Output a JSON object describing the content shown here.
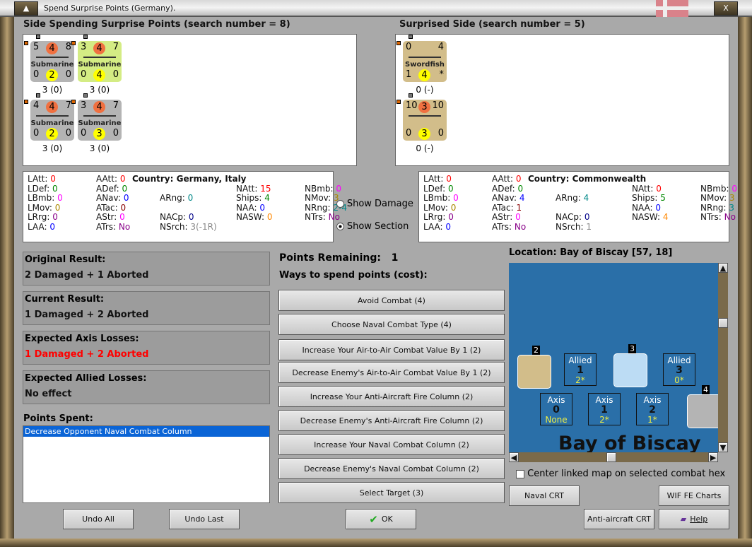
{
  "window": {
    "title": "Spend Surprise Points (Germany)."
  },
  "left_header": "Side Spending Surprise Points (search number = 8)",
  "right_header": "Surprised Side (search number = 5)",
  "left_units": [
    {
      "type": "Submarine",
      "top": [
        "5",
        "4",
        "8"
      ],
      "bottom": [
        "0",
        "2",
        "0"
      ],
      "caption": "3 (0)",
      "bg": "#b4b4b4"
    },
    {
      "type": "Submarine",
      "top": [
        "3",
        "4",
        "7"
      ],
      "bottom": [
        "0",
        "4",
        "0"
      ],
      "caption": "3 (0)",
      "bg": "#d4ec84"
    },
    {
      "type": "Submarine",
      "top": [
        "4",
        "4",
        "7"
      ],
      "bottom": [
        "0",
        "2",
        "0"
      ],
      "caption": "3 (0)",
      "bg": "#b4b4b4"
    },
    {
      "type": "Submarine",
      "top": [
        "3",
        "4",
        "7"
      ],
      "bottom": [
        "0",
        "3",
        "0"
      ],
      "caption": "3 (0)",
      "bg": "#b4b4b4"
    }
  ],
  "right_units": [
    {
      "type": "Swordfish",
      "top": [
        "0",
        "",
        "4"
      ],
      "bottom": [
        "1",
        "4",
        "*"
      ],
      "caption": "0 (-)",
      "bg": "#d2bd8a"
    },
    {
      "type": "",
      "top": [
        "10",
        "3",
        "10"
      ],
      "bottom": [
        "0",
        "3",
        "0"
      ],
      "caption": "0 (-)",
      "bg": "#d2bd8a"
    }
  ],
  "left_stats": {
    "country": "Country: Germany, Italy",
    "items": [
      [
        "LAtt:",
        "0",
        "#f00"
      ],
      [
        "LDef:",
        "0",
        "#080"
      ],
      [
        "LBmb:",
        "0",
        "#f0f"
      ],
      [
        "LMov:",
        "0",
        "#a80"
      ],
      [
        "LRrg:",
        "0",
        "#808"
      ],
      [
        "LAA:",
        "0",
        "#00f"
      ],
      [
        "AAtt:",
        "0",
        "#f00"
      ],
      [
        "ADef:",
        "0",
        "#080"
      ],
      [
        "ANav:",
        "0",
        "#00f"
      ],
      [
        "ATac:",
        "0",
        "#800"
      ],
      [
        "AStr:",
        "0",
        "#f0f"
      ],
      [
        "ATrs:",
        "No",
        "#808"
      ],
      [
        "ARng:",
        "0",
        "#088"
      ],
      [
        "NACp:",
        "0",
        "#008"
      ],
      [
        "NSrch:",
        "3(-1R)",
        "#888"
      ],
      [
        "NAtt:",
        "15",
        "#f00"
      ],
      [
        "Ships:",
        "4",
        "#080"
      ],
      [
        "NAA:",
        "0",
        "#00f"
      ],
      [
        "NASW:",
        "0",
        "#f80"
      ],
      [
        "NBmb:",
        "0",
        "#f0f"
      ],
      [
        "NMov:",
        "3",
        "#a80"
      ],
      [
        "NRng:",
        "2-4",
        "#088"
      ],
      [
        "NTrs:",
        "No",
        "#808"
      ]
    ]
  },
  "right_stats": {
    "country": "Country: Commonwealth",
    "items": [
      [
        "LAtt:",
        "0",
        "#f00"
      ],
      [
        "LDef:",
        "0",
        "#080"
      ],
      [
        "LBmb:",
        "0",
        "#f0f"
      ],
      [
        "LMov:",
        "0",
        "#a80"
      ],
      [
        "LRrg:",
        "0",
        "#808"
      ],
      [
        "LAA:",
        "0",
        "#00f"
      ],
      [
        "AAtt:",
        "0",
        "#f00"
      ],
      [
        "ADef:",
        "0",
        "#080"
      ],
      [
        "ANav:",
        "4",
        "#00f"
      ],
      [
        "ATac:",
        "1",
        "#800"
      ],
      [
        "AStr:",
        "0",
        "#f0f"
      ],
      [
        "ATrs:",
        "No",
        "#808"
      ],
      [
        "ARng:",
        "4",
        "#088"
      ],
      [
        "NACp:",
        "0",
        "#008"
      ],
      [
        "NSrch:",
        "1",
        "#888"
      ],
      [
        "NAtt:",
        "0",
        "#f00"
      ],
      [
        "Ships:",
        "5",
        "#080"
      ],
      [
        "NAA:",
        "0",
        "#00f"
      ],
      [
        "NASW:",
        "4",
        "#f80"
      ],
      [
        "NBmb:",
        "0",
        "#f0f"
      ],
      [
        "NMov:",
        "3",
        "#a80"
      ],
      [
        "NRng:",
        "3",
        "#088"
      ],
      [
        "NTrs:",
        "No",
        "#808"
      ]
    ]
  },
  "options": {
    "show_damage": "Show Damage",
    "show_section": "Show Section",
    "selected": "show_section"
  },
  "results": [
    {
      "label": "Original Result:",
      "value": "2 Damaged + 1 Aborted",
      "color": "#111"
    },
    {
      "label": "Current Result:",
      "value": "1 Damaged + 2 Aborted",
      "color": "#111"
    },
    {
      "label": "Expected Axis Losses:",
      "value": "1 Damaged + 2 Aborted",
      "color": "#f00"
    },
    {
      "label": "Expected Allied Losses:",
      "value": "No effect",
      "color": "#111"
    }
  ],
  "points_spent": {
    "label": "Points Spent:",
    "items": [
      "Decrease Opponent Naval Combat Column"
    ]
  },
  "points_remaining": {
    "label": "Points Remaining:",
    "value": "1"
  },
  "ways_label": "Ways to spend points (cost):",
  "ways": [
    "Avoid Combat (4)",
    "Choose Naval Combat Type (4)",
    "Increase Your Air-to-Air Combat Value By 1 (2)",
    "Decrease Enemy's Air-to-Air Combat Value By 1 (2)",
    "Increase Your Anti-Aircraft Fire Column (2)",
    "Decrease Enemy's Anti-Aircraft Fire Column (2)",
    "Increase Your Naval Combat Column (2)",
    "Decrease Enemy's Naval Combat Column (2)",
    "Select Target (3)"
  ],
  "map": {
    "location": "Location: Bay of Biscay [57, 18]",
    "sea_name": "Bay of Biscay",
    "boxes": [
      {
        "side": "Allied",
        "num": "1",
        "val": "2*"
      },
      {
        "side": "Allied",
        "num": "3",
        "val": "0*"
      },
      {
        "side": "Axis",
        "num": "0",
        "val": "None"
      },
      {
        "side": "Axis",
        "num": "1",
        "val": "2*"
      },
      {
        "side": "Axis",
        "num": "2",
        "val": "1*"
      }
    ],
    "unit_labels": [
      "2",
      "3",
      "4"
    ],
    "center_linked": "Center linked map on selected combat hex"
  },
  "buttons": {
    "naval_crt": "Naval CRT",
    "wif_charts": "WIF FE Charts",
    "undo_all": "Undo All",
    "undo_last": "Undo Last",
    "ok": "OK",
    "aa_crt": "Anti-aircraft CRT",
    "help": "Help"
  }
}
